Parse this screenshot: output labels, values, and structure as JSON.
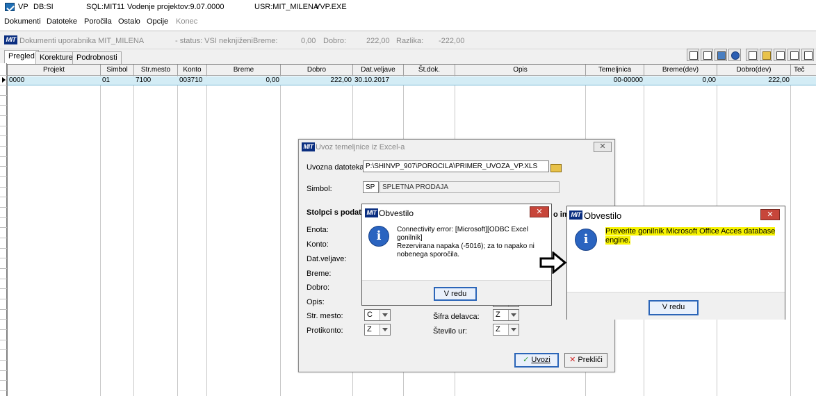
{
  "title_bar": {
    "app": "VP",
    "db": "DB:SI",
    "sql": "SQL:MIT11",
    "module": "Vodenje projektov:9.07.0000",
    "user": "USR:MIT_MILENA",
    "exe": "VVP.EXE"
  },
  "menu": {
    "items": [
      "Dokumenti",
      "Datoteke",
      "Poročila",
      "Ostalo",
      "Opcije",
      "Konec"
    ]
  },
  "doc_window": {
    "logo": "MIT",
    "title": "Dokumenti uporabnika MIT_MILENA",
    "status": "- status: VSI neknjiženi",
    "breme_label": "Breme:",
    "breme_value": "0,00",
    "dobro_label": "Dobro:",
    "dobro_value": "222,00",
    "razlika_label": "Razlika:",
    "razlika_value": "-222,00"
  },
  "tabs": [
    {
      "label": "Pregled",
      "active": true
    },
    {
      "label": "Korekture",
      "active": false
    },
    {
      "label": "Podrobnosti",
      "active": false
    }
  ],
  "toolbar": {
    "icons": [
      "report-icon",
      "print-preview-icon",
      "monitor-icon",
      "help-icon",
      "new-document-icon",
      "open-folder-icon",
      "printer-icon",
      "search-icon",
      "filter-icon"
    ]
  },
  "grid": {
    "columns": [
      "Projekt",
      "Simbol",
      "Str.mesto",
      "Konto",
      "Breme",
      "Dobro",
      "Dat.veljave",
      "Št.dok.",
      "Opis",
      "Temeljnica",
      "Breme(dev)",
      "Dobro(dev)",
      "Teč"
    ],
    "rows": [
      [
        "0000",
        "01",
        "7100",
        "003710",
        "0,00",
        "222,00",
        "30.10.2017",
        "",
        "",
        "00-00000",
        "0,00",
        "222,00",
        ""
      ]
    ]
  },
  "import_dialog": {
    "logo": "MIT",
    "title": "Uvoz temeljnice iz Excel-a",
    "close": "✕",
    "file_label": "Uvozna datoteka:",
    "file_value": "P:\\SHINVP_907\\POROCILA\\PRIMER_UVOZA_VP.XLS",
    "symbol_label": "Simbol:",
    "symbol_code": "SP",
    "symbol_name": "SPLETNA PRODAJA",
    "columns_heading": "Stolpci s podatk",
    "columns_heading_tail": "o im",
    "fields": [
      {
        "label": "Enota:"
      },
      {
        "label": "Konto:"
      },
      {
        "label": "Dat.veljave:"
      },
      {
        "label": "Breme:"
      },
      {
        "label": "Dobro:"
      },
      {
        "label": "Opis:"
      },
      {
        "label": "Str. mesto:",
        "value": "C"
      },
      {
        "label": "Protikonto:",
        "value": "Z"
      }
    ],
    "right_fields": [
      {
        "label": "Šifra delavca:",
        "value": "Z"
      },
      {
        "label": "Število ur:",
        "value": "Z"
      }
    ],
    "import_button": "Uvozi",
    "cancel_button": "Prekliči"
  },
  "error_box": {
    "logo": "MIT",
    "title": "Obvestilo",
    "close": "✕",
    "message_lines": [
      "Connectivity error: [Microsoft][ODBC Excel gonilnik]",
      "Rezervirana napaka (-5016); za to napako ni",
      "nobenega sporočila."
    ],
    "ok_button": "V redu"
  },
  "notice_box": {
    "logo": "MIT",
    "title": "Obvestilo",
    "close": "✕",
    "message_lines": [
      "Preverite gonilnik Microsoft Office Acces database",
      "engine."
    ],
    "highlight_color": "#f7f300",
    "ok_button": "V redu"
  },
  "colors": {
    "selected_row": "#d3ecf5",
    "logo_blue": "#0a2e80",
    "info_blue": "#2a64c0",
    "close_red": "#c7463a"
  }
}
